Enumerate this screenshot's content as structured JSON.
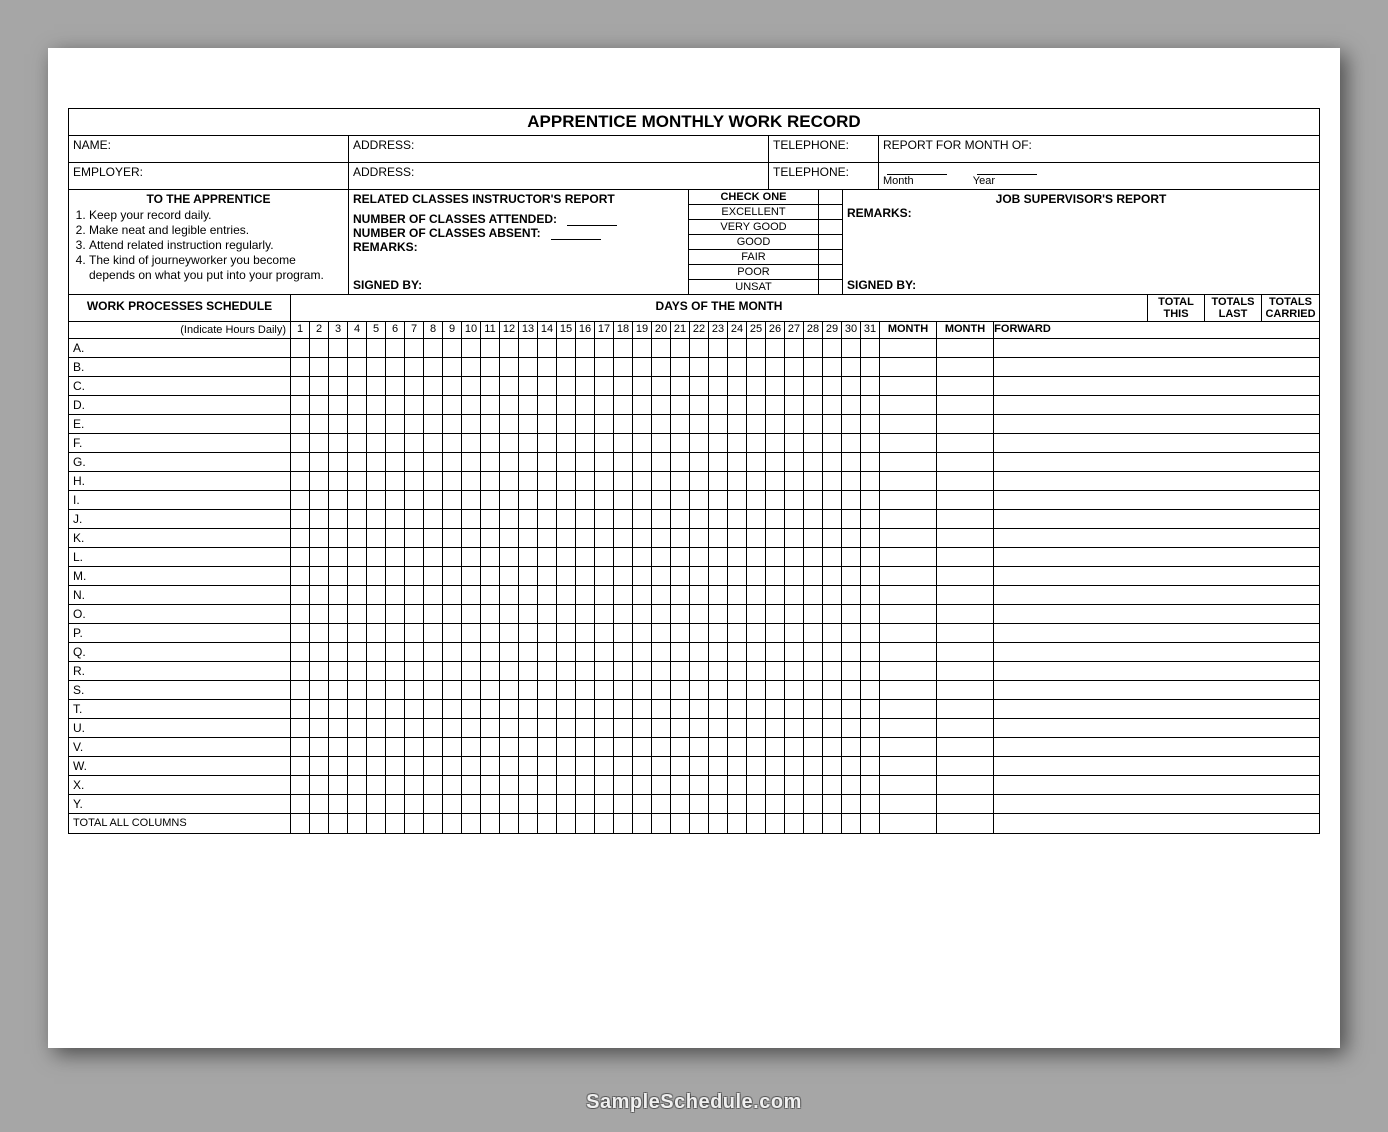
{
  "title": "APPRENTICE MONTHLY WORK RECORD",
  "header": {
    "name": "NAME:",
    "employer": "EMPLOYER:",
    "address": "ADDRESS:",
    "telephone": "TELEPHONE:",
    "report": "REPORT FOR MONTH OF:",
    "month": "Month",
    "year": "Year"
  },
  "apprentice": {
    "heading": "TO THE APPRENTICE",
    "items": [
      "Keep your record daily.",
      "Make neat and legible entries.",
      "Attend related instruction regularly.",
      "The kind of journeyworker you become depends on what you put into your program."
    ]
  },
  "instructor": {
    "heading": "RELATED CLASSES INSTRUCTOR'S REPORT",
    "attended": "NUMBER OF CLASSES ATTENDED:",
    "absent": "NUMBER OF CLASSES ABSENT:",
    "remarks": "REMARKS:",
    "signed": "SIGNED BY:"
  },
  "check": {
    "heading": "CHECK ONE",
    "options": [
      "EXCELLENT",
      "VERY GOOD",
      "GOOD",
      "FAIR",
      "POOR",
      "UNSAT"
    ]
  },
  "supervisor": {
    "heading": "JOB SUPERVISOR'S REPORT",
    "remarks": "REMARKS:",
    "signed": "SIGNED BY:"
  },
  "schedule": {
    "wp": "WORK PROCESSES SCHEDULE",
    "dom": "DAYS OF THE MONTH",
    "ind": "(Indicate Hours Daily)",
    "totals": [
      "TOTAL THIS MONTH",
      "TOTALS LAST MONTH",
      "TOTALS CARRIED FORWARD"
    ],
    "totals1": [
      "TOTAL",
      "TOTALS",
      "TOTALS"
    ],
    "totals2": [
      "THIS",
      "LAST",
      "CARRIED"
    ],
    "totals3": [
      "MONTH",
      "MONTH",
      "FORWARD"
    ],
    "days": [
      "1",
      "2",
      "3",
      "4",
      "5",
      "6",
      "7",
      "8",
      "9",
      "10",
      "11",
      "12",
      "13",
      "14",
      "15",
      "16",
      "17",
      "18",
      "19",
      "20",
      "21",
      "22",
      "23",
      "24",
      "25",
      "26",
      "27",
      "28",
      "29",
      "30",
      "31"
    ],
    "rows": [
      "A.",
      "B.",
      "C.",
      "D.",
      "E.",
      "F.",
      "G.",
      "H.",
      "I.",
      "J.",
      "K.",
      "L.",
      "M.",
      "N.",
      "O.",
      "P.",
      "Q.",
      "R.",
      "S.",
      "T.",
      "U.",
      "V.",
      "W.",
      "X.",
      "Y."
    ],
    "total_row": "TOTAL ALL COLUMNS"
  },
  "footer": "SampleSchedule.com"
}
